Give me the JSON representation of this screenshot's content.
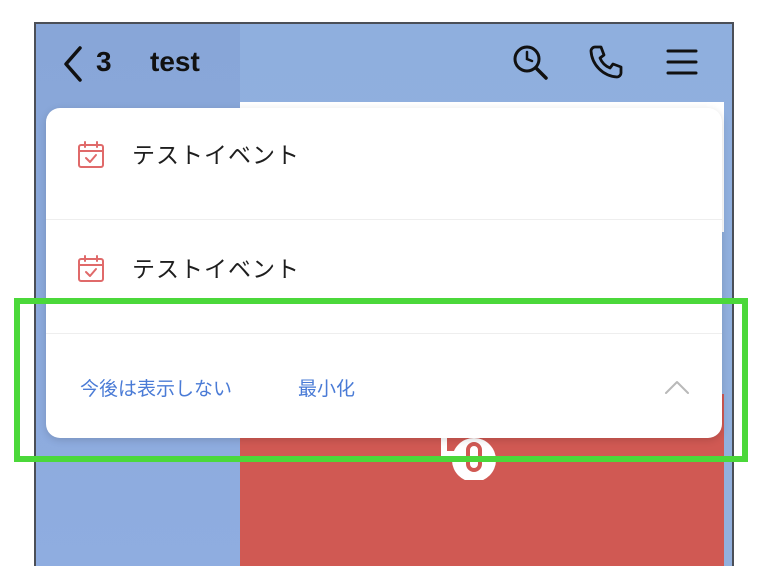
{
  "header": {
    "unread_count": "3",
    "title": "test"
  },
  "icons": {
    "back": "chevron-left-icon",
    "search": "search-icon",
    "call": "phone-icon",
    "menu": "hamburger-menu-icon",
    "event": "calendar-check-icon",
    "collapse": "chevron-up-icon"
  },
  "events": [
    {
      "label": "テストイベント"
    },
    {
      "label": "テストイベント"
    }
  ],
  "footer": {
    "hide_label": "今後は表示しない",
    "minimize_label": "最小化"
  },
  "colors": {
    "chat_background": "#8fafde",
    "link": "#4a7bd6",
    "calendar_icon": "#e06a6a",
    "highlight_frame": "#4bd83a",
    "red_card": "#d05953"
  }
}
